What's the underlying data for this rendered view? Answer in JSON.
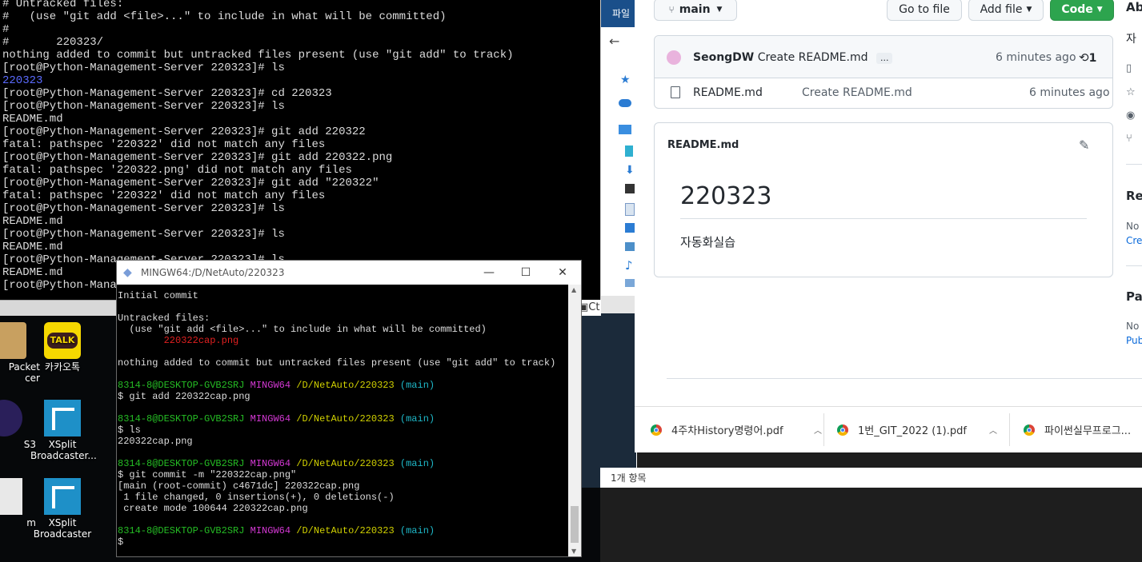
{
  "terminal_top": {
    "lines": [
      "# Untracked files:",
      "#   (use \"git add <file>...\" to include in what will be committed)",
      "#",
      "#       220323/",
      "nothing added to commit but untracked files present (use \"git add\" to track)",
      "[root@Python-Management-Server 220323]# ls",
      "220323",
      "[root@Python-Management-Server 220323]# cd 220323",
      "[root@Python-Management-Server 220323]# ls",
      "README.md",
      "[root@Python-Management-Server 220323]# git add 220322",
      "fatal: pathspec '220322' did not match any files",
      "[root@Python-Management-Server 220323]# git add 220322.png",
      "fatal: pathspec '220322.png' did not match any files",
      "[root@Python-Management-Server 220323]# git add \"220322\"",
      "fatal: pathspec '220322' did not match any files",
      "[root@Python-Management-Server 220323]# ls",
      "README.md",
      "[root@Python-Management-Server 220323]# ls",
      "README.md",
      "[root@Python-Management-Server 220323]# ls",
      "README.md",
      "[root@Python-Management-Server 220323]# "
    ]
  },
  "desktop": {
    "icons": [
      {
        "label": "Packet\ncer"
      },
      {
        "label": "카카오톡"
      },
      {
        "label": "S3"
      },
      {
        "label": "XSplit\nBroadcaster..."
      },
      {
        "label": "m"
      },
      {
        "label": "XSplit\nBroadcaster"
      }
    ],
    "talk_badge": "TALK"
  },
  "explorer": {
    "menu": "파일",
    "status": "1개 항목",
    "partial_item": "Ct"
  },
  "bash": {
    "title": "MINGW64:/D/NetAuto/220323",
    "controls": {
      "min": "—",
      "max": "☐",
      "close": "✕"
    },
    "lines": [
      {
        "t": "Initial commit"
      },
      {
        "t": ""
      },
      {
        "t": "Untracked files:"
      },
      {
        "t": "  (use \"git add <file>...\" to include in what will be committed)"
      },
      {
        "t": "        220322cap.png",
        "cls": "r"
      },
      {
        "t": ""
      },
      {
        "t": "nothing added to commit but untracked files present (use \"git add\" to track)"
      },
      {
        "t": ""
      },
      {
        "prompt": true
      },
      {
        "t": "$ git add 220322cap.png"
      },
      {
        "t": ""
      },
      {
        "prompt": true
      },
      {
        "t": "$ ls"
      },
      {
        "t": "220322cap.png"
      },
      {
        "t": ""
      },
      {
        "prompt": true
      },
      {
        "t": "$ git commit -m \"220322cap.png\""
      },
      {
        "t": "[main (root-commit) c4671dc] 220322cap.png"
      },
      {
        "t": " 1 file changed, 0 insertions(+), 0 deletions(-)"
      },
      {
        "t": " create mode 100644 220322cap.png"
      },
      {
        "t": ""
      },
      {
        "prompt": true
      },
      {
        "t": "$ "
      }
    ],
    "prompt": {
      "user": "8314-8@DESKTOP-GVB2SRJ",
      "env": "MINGW64",
      "path": "/D/NetAuto/220323",
      "branch": "(main)"
    }
  },
  "github": {
    "branch_button": "main",
    "goto_file": "Go to file",
    "add_file": "Add file",
    "code": "Code",
    "commit": {
      "author": "SeongDW",
      "message": "Create README.md",
      "ellipsis": "...",
      "time": "6 minutes ago",
      "count": "1"
    },
    "files": [
      {
        "name": "README.md",
        "message": "Create README.md",
        "time": "6 minutes ago"
      }
    ],
    "readme": {
      "label": "README.md",
      "heading": "220323",
      "body": "자동화실습"
    },
    "sidebar": {
      "about": "Ab",
      "about_text": "자",
      "releases": "Rel",
      "releases_no": "No",
      "releases_link": "Crea",
      "packages": "Pac",
      "packages_no": "No",
      "packages_link": "Pub"
    }
  },
  "downloads": {
    "items": [
      "4주차History명령어.pdf",
      "1번_GIT_2022 (1).pdf",
      "파이썬실무프로그..."
    ]
  }
}
